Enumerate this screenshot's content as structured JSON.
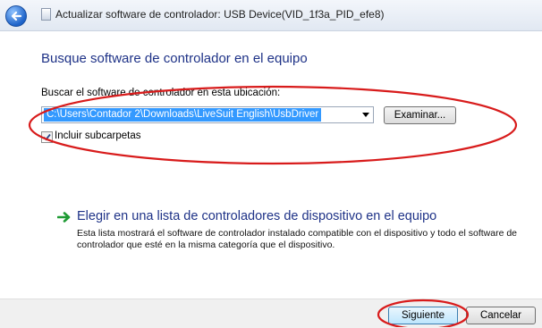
{
  "window": {
    "title": "Actualizar software de controlador: USB Device(VID_1f3a_PID_efe8)",
    "back_icon": "back-arrow-icon",
    "title_icon": "device-icon"
  },
  "main": {
    "heading": "Busque software de controlador en el equipo",
    "path_label": "Buscar el software de controlador en esta ubicación:",
    "path_value": "C:\\Users\\Contador 2\\Downloads\\LiveSuit English\\UsbDriver",
    "browse_label": "Examinar...",
    "include_subfolders_label": "Incluir subcarpetas",
    "include_subfolders_checked": true
  },
  "option": {
    "icon": "green-arrow-icon",
    "title": "Elegir en una lista de controladores de dispositivo en el equipo",
    "description": "Esta lista mostrará el software de controlador instalado compatible con el dispositivo y todo el software de controlador que esté en la misma categoría que el dispositivo."
  },
  "footer": {
    "next_label": "Siguiente",
    "cancel_label": "Cancelar"
  },
  "annotations": {
    "color": "#d81b1b"
  }
}
